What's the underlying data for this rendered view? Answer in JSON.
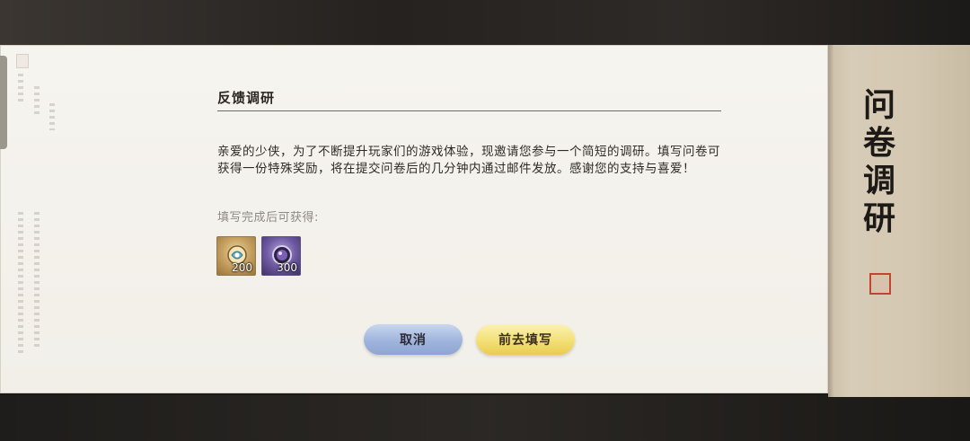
{
  "dialog": {
    "title": "反馈调研",
    "body": "亲爱的少侠，为了不断提升玩家们的游戏体验，现邀请您参与一个简短的调研。填写问卷可获得一份特殊奖励，将在提交问卷后的几分钟内通过邮件发放。感谢您的支持与喜爱！",
    "reward_label": "填写完成后可获得:",
    "rewards": [
      {
        "icon": "gold-item-icon",
        "quantity": "200"
      },
      {
        "icon": "purple-orb-icon",
        "quantity": "300"
      }
    ],
    "buttons": {
      "cancel_label": "取消",
      "confirm_label": "前去填写"
    }
  },
  "side_panel": {
    "calligraphy": [
      "问",
      "卷",
      "调",
      "研"
    ],
    "seal_color": "#c4452f"
  }
}
